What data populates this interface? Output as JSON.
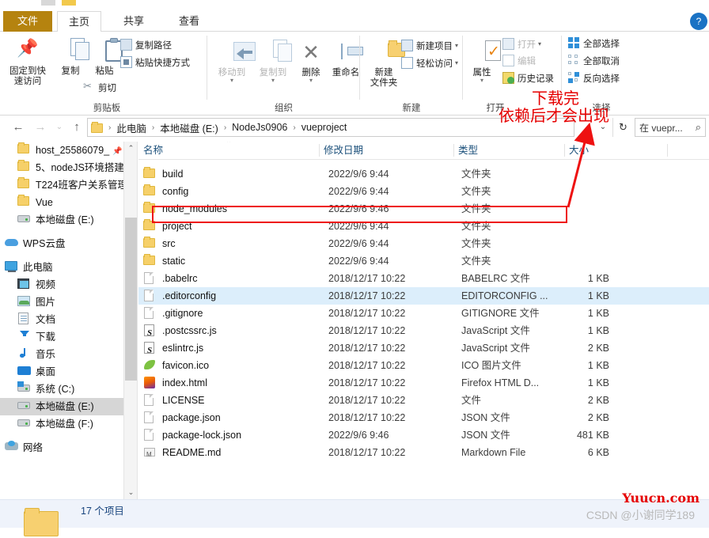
{
  "window": {
    "collapse_icon": "chevron-up-icon",
    "help_badge": "?"
  },
  "ribbon": {
    "tabs": [
      {
        "label": "文件",
        "active": false,
        "kind": "file"
      },
      {
        "label": "主页",
        "active": true
      },
      {
        "label": "共享",
        "active": false
      },
      {
        "label": "查看",
        "active": false
      }
    ],
    "groups": [
      {
        "name": "剪贴板",
        "big_buttons": [
          {
            "label_line1": "固定到快",
            "label_line2": "速访问",
            "icon": "pin-icon"
          },
          {
            "label_line1": "复制",
            "label_line2": "",
            "icon": "copy-icon"
          },
          {
            "label_line1": "粘贴",
            "label_line2": "",
            "icon": "paste-icon"
          }
        ],
        "small_buttons": [
          {
            "label": "复制路径",
            "icon": "copy-path-icon"
          },
          {
            "label": "粘贴快捷方式",
            "icon": "paste-shortcut-icon"
          },
          {
            "label": "剪切",
            "icon": "scissors-icon"
          }
        ]
      },
      {
        "name": "组织",
        "big_buttons": [
          {
            "label_line1": "移动到",
            "icon": "move-to-icon",
            "dim": true
          },
          {
            "label_line1": "复制到",
            "icon": "copy-to-icon",
            "dim": true
          },
          {
            "label_line1": "删除",
            "icon": "delete-icon"
          },
          {
            "label_line1": "重命名",
            "icon": "rename-icon"
          }
        ]
      },
      {
        "name": "新建",
        "big_buttons": [
          {
            "label_line1": "新建",
            "label_line2": "文件夹",
            "icon": "new-folder-icon"
          }
        ],
        "small_buttons": [
          {
            "label": "新建项目",
            "icon": "new-item-icon",
            "has_caret": true
          },
          {
            "label": "轻松访问",
            "icon": "easy-access-icon",
            "has_caret": true
          }
        ]
      },
      {
        "name": "打开",
        "big_buttons": [
          {
            "label_line1": "属性",
            "icon": "properties-icon"
          }
        ],
        "small_buttons": [
          {
            "label": "打开",
            "icon": "open-icon",
            "has_caret": true,
            "dim": true
          },
          {
            "label": "编辑",
            "icon": "edit-icon",
            "dim": true
          },
          {
            "label": "历史记录",
            "icon": "history-icon"
          }
        ]
      },
      {
        "name": "选择",
        "small_buttons": [
          {
            "label": "全部选择",
            "icon": "select-all-icon"
          },
          {
            "label": "全部取消",
            "icon": "select-none-icon"
          },
          {
            "label": "反向选择",
            "icon": "invert-selection-icon"
          }
        ]
      }
    ]
  },
  "addressbar": {
    "back": "←",
    "forward": "→",
    "recent_caret": "⌄",
    "up": "↑",
    "breadcrumbs": [
      "此电脑",
      "本地磁盘 (E:)",
      "NodeJs0906",
      "vueproject"
    ],
    "separator": "›",
    "dropdown": "⌄",
    "refresh": "↻",
    "search_placeholder": "在 vuepr...",
    "search_value": "",
    "search_icon": "magnifier-icon"
  },
  "nav": {
    "items": [
      {
        "label": "host_25586079_",
        "icon": "folder-icon",
        "pinned": true,
        "indent": 1
      },
      {
        "label": "5、nodeJS环境搭建",
        "icon": "folder-icon",
        "indent": 1
      },
      {
        "label": "T224班客户关系管理",
        "icon": "folder-icon",
        "indent": 1
      },
      {
        "label": "Vue",
        "icon": "folder-icon",
        "indent": 1
      },
      {
        "label": "本地磁盘 (E:)",
        "icon": "drive-icon",
        "indent": 1
      },
      {
        "label": "WPS云盘",
        "icon": "cloud-icon",
        "indent": 0
      },
      {
        "label": "此电脑",
        "icon": "computer-icon",
        "indent": 0
      },
      {
        "label": "视频",
        "icon": "videos-icon",
        "indent": 1
      },
      {
        "label": "图片",
        "icon": "pictures-icon",
        "indent": 1
      },
      {
        "label": "文档",
        "icon": "documents-icon",
        "indent": 1
      },
      {
        "label": "下载",
        "icon": "downloads-icon",
        "indent": 1
      },
      {
        "label": "音乐",
        "icon": "music-icon",
        "indent": 1
      },
      {
        "label": "桌面",
        "icon": "desktop-icon",
        "indent": 1
      },
      {
        "label": "系统 (C:)",
        "icon": "system-drive-icon",
        "indent": 1
      },
      {
        "label": "本地磁盘 (E:)",
        "icon": "drive-icon",
        "indent": 1,
        "selected": true
      },
      {
        "label": "本地磁盘 (F:)",
        "icon": "drive-icon",
        "indent": 1
      },
      {
        "label": "网络",
        "icon": "network-icon",
        "indent": 0
      }
    ],
    "scroll_up": "⌃",
    "scroll_down": "⌄"
  },
  "list": {
    "columns": [
      {
        "key": "name",
        "label": "名称",
        "sorted": true
      },
      {
        "key": "date",
        "label": "修改日期"
      },
      {
        "key": "type",
        "label": "类型"
      },
      {
        "key": "size",
        "label": "大小"
      }
    ],
    "sort_marker": "⌃",
    "rows": [
      {
        "name": "build",
        "date": "2022/9/6 9:44",
        "type": "文件夹",
        "size": "",
        "icon": "folder-icon"
      },
      {
        "name": "config",
        "date": "2022/9/6 9:44",
        "type": "文件夹",
        "size": "",
        "icon": "folder-icon"
      },
      {
        "name": "node_modules",
        "date": "2022/9/6 9:46",
        "type": "文件夹",
        "size": "",
        "icon": "folder-icon",
        "highlighted": true
      },
      {
        "name": "project",
        "date": "2022/9/6 9:44",
        "type": "文件夹",
        "size": "",
        "icon": "folder-icon"
      },
      {
        "name": "src",
        "date": "2022/9/6 9:44",
        "type": "文件夹",
        "size": "",
        "icon": "folder-icon"
      },
      {
        "name": "static",
        "date": "2022/9/6 9:44",
        "type": "文件夹",
        "size": "",
        "icon": "folder-icon"
      },
      {
        "name": ".babelrc",
        "date": "2018/12/17 10:22",
        "type": "BABELRC 文件",
        "size": "1 KB",
        "icon": "file-icon"
      },
      {
        "name": ".editorconfig",
        "date": "2018/12/17 10:22",
        "type": "EDITORCONFIG ...",
        "size": "1 KB",
        "icon": "file-icon",
        "selected": true
      },
      {
        "name": ".gitignore",
        "date": "2018/12/17 10:22",
        "type": "GITIGNORE 文件",
        "size": "1 KB",
        "icon": "file-icon"
      },
      {
        "name": ".postcssrc.js",
        "date": "2018/12/17 10:22",
        "type": "JavaScript 文件",
        "size": "1 KB",
        "icon": "js-file-icon"
      },
      {
        "name": "eslintrc.js",
        "date": "2018/12/17 10:22",
        "type": "JavaScript 文件",
        "size": "2 KB",
        "icon": "js-file-icon"
      },
      {
        "name": "favicon.ico",
        "date": "2018/12/17 10:22",
        "type": "ICO 图片文件",
        "size": "1 KB",
        "icon": "ico-file-icon"
      },
      {
        "name": "index.html",
        "date": "2018/12/17 10:22",
        "type": "Firefox HTML D...",
        "size": "1 KB",
        "icon": "firefox-file-icon"
      },
      {
        "name": "LICENSE",
        "date": "2018/12/17 10:22",
        "type": "文件",
        "size": "2 KB",
        "icon": "file-icon"
      },
      {
        "name": "package.json",
        "date": "2018/12/17 10:22",
        "type": "JSON 文件",
        "size": "2 KB",
        "icon": "file-icon"
      },
      {
        "name": "package-lock.json",
        "date": "2022/9/6 9:46",
        "type": "JSON 文件",
        "size": "481 KB",
        "icon": "file-icon"
      },
      {
        "name": "README.md",
        "date": "2018/12/17 10:22",
        "type": "Markdown File",
        "size": "6 KB",
        "icon": "md-file-icon"
      }
    ]
  },
  "status": {
    "item_count": "17 个项目",
    "preview_icon": "folder-icon"
  },
  "annotations": {
    "note_line1": "下载完",
    "note_line2": "依赖后才会出现",
    "color": "#e60000",
    "watermark_red": "Yuucn.com",
    "watermark_gray": "CSDN @小谢同学189"
  }
}
